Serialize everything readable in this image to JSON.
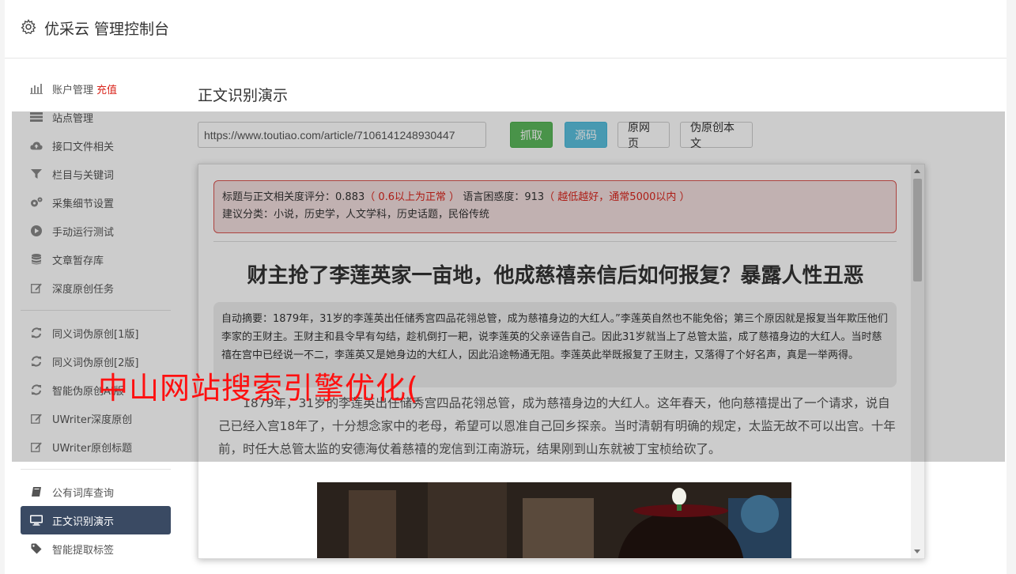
{
  "header": {
    "title": "优采云 管理控制台",
    "icon": "gear-icon"
  },
  "sidebar": {
    "group1": [
      {
        "label": "账户管理",
        "badge": "充值",
        "icon": "bar-chart-icon"
      },
      {
        "label": "站点管理",
        "icon": "server-icon"
      },
      {
        "label": "接口文件相关",
        "icon": "cloud-upload-icon"
      },
      {
        "label": "栏目与关键词",
        "icon": "filter-icon"
      },
      {
        "label": "采集细节设置",
        "icon": "cogs-icon"
      },
      {
        "label": "手动运行测试",
        "icon": "play-circle-icon"
      },
      {
        "label": "文章暂存库",
        "icon": "database-icon"
      },
      {
        "label": "深度原创任务",
        "icon": "edit-icon"
      }
    ],
    "group2": [
      {
        "label": "同义词伪原创[1版]",
        "icon": "refresh-icon"
      },
      {
        "label": "同义词伪原创[2版]",
        "icon": "refresh-icon"
      },
      {
        "label": "智能伪原创AI版",
        "icon": "refresh-icon"
      },
      {
        "label": "UWriter深度原创",
        "icon": "edit-icon"
      },
      {
        "label": "UWriter原创标题",
        "icon": "edit-icon"
      }
    ],
    "group3": [
      {
        "label": "公有词库查询",
        "icon": "book-icon"
      },
      {
        "label": "正文识别演示",
        "icon": "desktop-icon",
        "active": true
      },
      {
        "label": "智能提取标签",
        "icon": "tag-icon"
      }
    ]
  },
  "main": {
    "page_title": "正文识别演示",
    "url_value": "https://www.toutiao.com/article/7106141248930447",
    "buttons": {
      "grab": "抓取",
      "source": "源码",
      "original": "原网页",
      "pseudo": "伪原创本文"
    }
  },
  "article": {
    "score": {
      "relevance_label": "标题与正文相关度评分：",
      "relevance_value": "0.883",
      "relevance_note": "（ 0.6以上为正常 ）",
      "perplexity_label": "语言困惑度：",
      "perplexity_value": "913",
      "perplexity_note": "（ 越低越好，通常5000以内 ）",
      "category_line": "建议分类：小说，历史学，人文学科，历史话题，民俗传统"
    },
    "title": "财主抢了李莲英家一亩地，他成慈禧亲信后如何报复？暴露人性丑恶",
    "summary": "自动摘要：1879年，31岁的李莲英出任储秀宫四品花翎总管，成为慈禧身边的大红人。”李莲英自然也不能免俗；第三个原因就是报复当年欺压他们李家的王财主。王财主和县令早有勾结，趁机倒打一耙，说李莲英的父亲诬告自己。因此31岁就当上了总管太监，成了慈禧身边的大红人。当时慈禧在宫中已经说一不二，李莲英又是她身边的大红人，因此沿途畅通无阻。李莲英此举既报复了王财主，又落得了个好名声，真是一举两得。",
    "body": "1879年，31岁的李莲英出任储秀宫四品花翎总管，成为慈禧身边的大红人。这年春天，他向慈禧提出了一个请求，说自己已经入宫18年了，十分想念家中的老母，希望可以恩准自己回乡探亲。当时清朝有明确的规定，太监无故不可以出宫。十年前，时任大总管太监的安德海仗着慈禧的宠信到江南游玩，结果刚到山东就被丁宝桢给砍了。"
  },
  "watermark": "中山网站搜索引擎优化("
}
